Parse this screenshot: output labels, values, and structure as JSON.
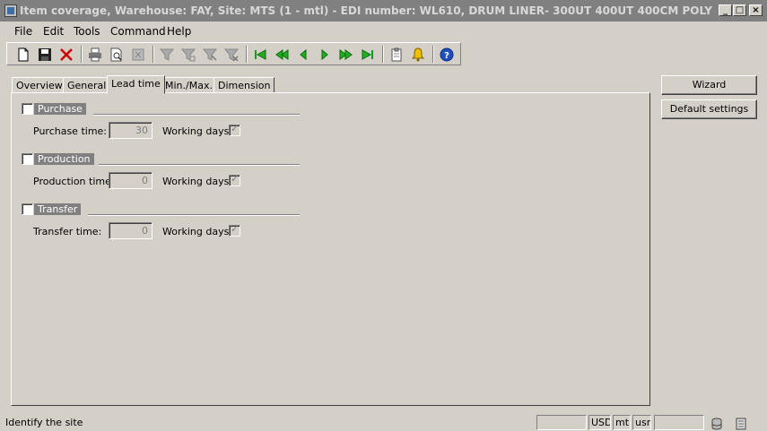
{
  "window": {
    "title": "Item coverage, Warehouse: FAY, Site: MTS (1 - mtl) - EDI number: WL610, DRUM LINER- 300UT 400UT 400CM POLY",
    "min_glyph": "_",
    "max_glyph": "□",
    "close_glyph": "×"
  },
  "menu": [
    "File",
    "Edit",
    "Tools",
    "Command",
    "Help"
  ],
  "tabs": [
    "Overview",
    "General",
    "Lead time",
    "Min./Max.",
    "Dimension"
  ],
  "active_tab": "Lead time",
  "groups": {
    "purchase": {
      "label": "Purchase",
      "field_label": "Purchase time:",
      "value": "30",
      "working_days_label": "Working days:"
    },
    "production": {
      "label": "Production",
      "field_label": "Production time:",
      "value": "0",
      "working_days_label": "Working days:"
    },
    "transfer": {
      "label": "Transfer",
      "field_label": "Transfer time:",
      "value": "0",
      "working_days_label": "Working days:"
    }
  },
  "buttons": {
    "wizard": "Wizard",
    "default_settings": "Default settings"
  },
  "status": {
    "message": "Identify the site",
    "currency": "USD",
    "company": "mtl",
    "user": "usr"
  }
}
